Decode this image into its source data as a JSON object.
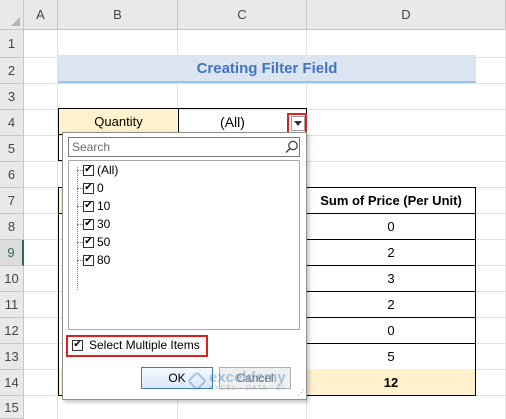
{
  "columns": [
    "A",
    "B",
    "C",
    "D"
  ],
  "rows": [
    "1",
    "2",
    "3",
    "4",
    "5",
    "6",
    "7",
    "8",
    "9",
    "10",
    "11",
    "12",
    "13",
    "14",
    "15"
  ],
  "title": "Creating Filter Field",
  "filter_field": {
    "label": "Quantity",
    "value": "(All)"
  },
  "table": {
    "header": "Sum of Price (Per Unit)",
    "values": [
      "0",
      "2",
      "3",
      "2",
      "0",
      "5"
    ],
    "total": "12"
  },
  "dropdown": {
    "search_placeholder": "Search",
    "items": [
      "(All)",
      "0",
      "10",
      "30",
      "50",
      "80"
    ],
    "select_multiple_label": "Select Multiple Items",
    "ok_label": "OK",
    "cancel_label": "Cancel"
  },
  "watermark": {
    "name": "exceldemy",
    "tagline": "EXCEL · DATA · BI"
  },
  "colors": {
    "title_text": "#4472c4",
    "title_bg": "#dbe5f1",
    "filter_bg": "#fff2cc",
    "highlight_red": "#e0201b",
    "selected_header": "#217346"
  }
}
